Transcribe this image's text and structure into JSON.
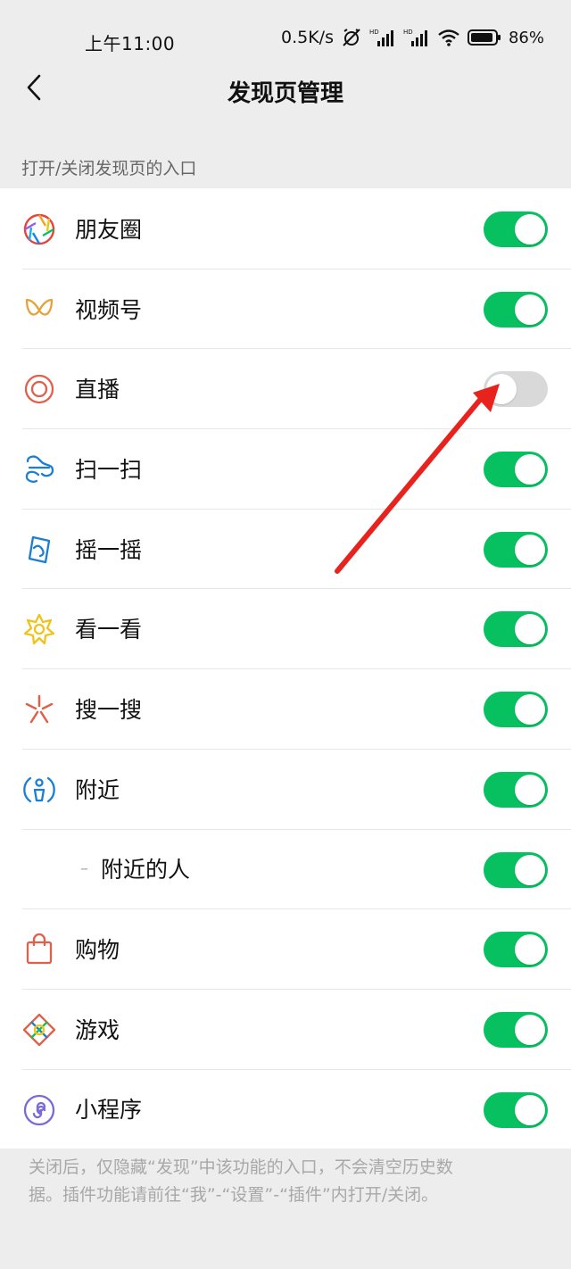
{
  "status": {
    "time": "上午11:00",
    "speed": "0.5K/s",
    "battery": "86"
  },
  "nav": {
    "back_icon": "chevron-left-icon",
    "title": "发现页管理"
  },
  "section": {
    "header": "打开/关闭发现页的入口"
  },
  "items": [
    {
      "label": "朋友圈",
      "icon": "moments-icon",
      "on": true
    },
    {
      "label": "视频号",
      "icon": "channels-icon",
      "on": true
    },
    {
      "label": "直播",
      "icon": "live-icon",
      "on": false
    },
    {
      "label": "扫一扫",
      "icon": "scan-icon",
      "on": true
    },
    {
      "label": "摇一摇",
      "icon": "shake-icon",
      "on": true
    },
    {
      "label": "看一看",
      "icon": "top-stories-icon",
      "on": true
    },
    {
      "label": "搜一搜",
      "icon": "search-icon",
      "on": true
    },
    {
      "label": "附近",
      "icon": "nearby-icon",
      "on": true
    },
    {
      "label": "附近的人",
      "icon": "",
      "on": true
    },
    {
      "label": "购物",
      "icon": "shopping-bag-icon",
      "on": true
    },
    {
      "label": "游戏",
      "icon": "games-icon",
      "on": true
    },
    {
      "label": "小程序",
      "icon": "mini-program-icon",
      "on": true
    }
  ],
  "footer": {
    "line1": "关闭后，仅隐藏“发现”中该功能的入口，不会清空历史数",
    "line2": "据。插件功能请前往“我”-“设置”-“插件”内打开/关闭。"
  },
  "colors": {
    "toggle_on": "#07c160",
    "toggle_off": "#d9d9d9",
    "annotation_arrow": "#e8231e"
  }
}
